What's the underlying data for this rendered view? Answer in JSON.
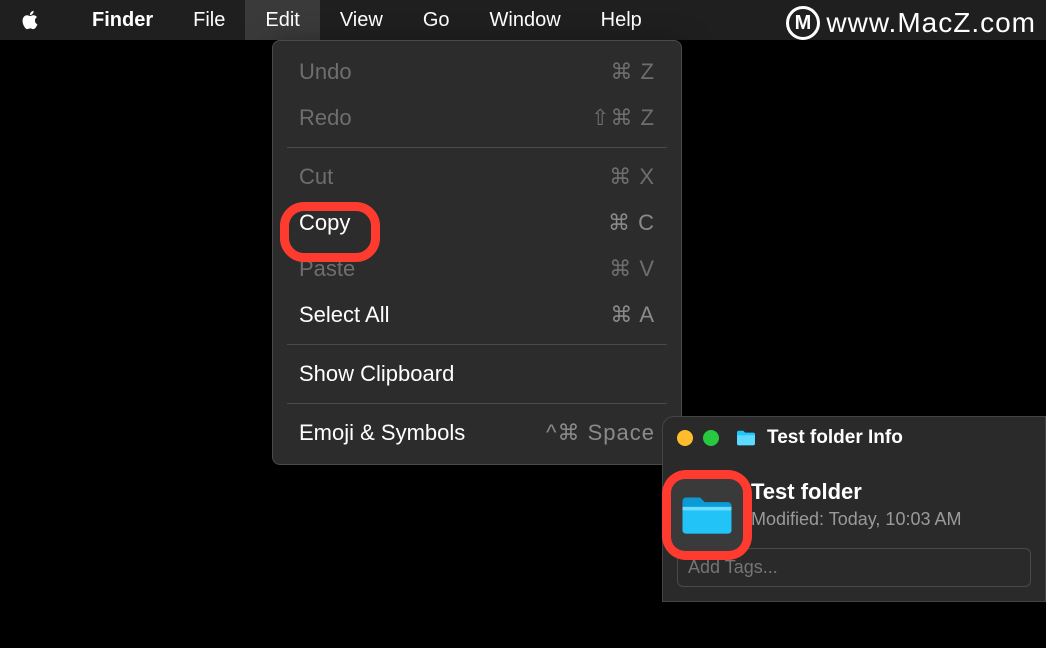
{
  "menubar": {
    "app_name": "Finder",
    "items": [
      "File",
      "Edit",
      "View",
      "Go",
      "Window",
      "Help"
    ],
    "active": "Edit"
  },
  "edit_menu": {
    "groups": [
      [
        {
          "label": "Undo",
          "shortcut": "⌘ Z",
          "enabled": false
        },
        {
          "label": "Redo",
          "shortcut": "⇧⌘ Z",
          "enabled": false
        }
      ],
      [
        {
          "label": "Cut",
          "shortcut": "⌘ X",
          "enabled": false
        },
        {
          "label": "Copy",
          "shortcut": "⌘ C",
          "enabled": true
        },
        {
          "label": "Paste",
          "shortcut": "⌘ V",
          "enabled": false
        },
        {
          "label": "Select All",
          "shortcut": "⌘ A",
          "enabled": true
        }
      ],
      [
        {
          "label": "Show Clipboard",
          "shortcut": "",
          "enabled": true
        }
      ],
      [
        {
          "label": "Emoji & Symbols",
          "shortcut": "^⌘ Space",
          "enabled": true
        }
      ]
    ]
  },
  "info_window": {
    "title": "Test folder Info",
    "name": "Test folder",
    "modified_label": "Modified:",
    "modified_value": "Today, 10:03 AM",
    "tags_placeholder": "Add Tags..."
  },
  "watermark": {
    "text": "www.MacZ.com",
    "logo": "M"
  }
}
